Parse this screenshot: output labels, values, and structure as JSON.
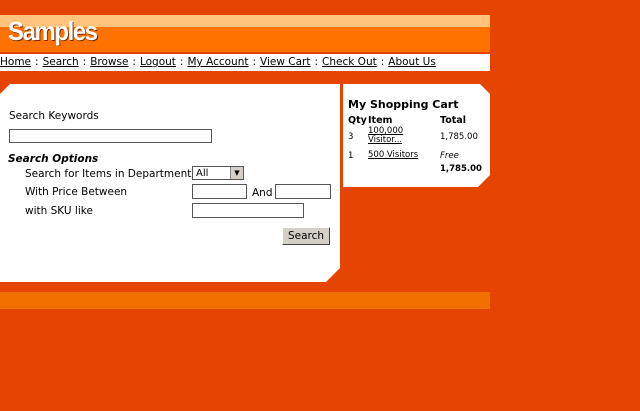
{
  "header": {
    "logo_text": "Samples"
  },
  "nav": {
    "items": [
      "Home",
      "Search",
      "Browse",
      "Logout",
      "My Account",
      "View Cart",
      "Check Out",
      "About Us"
    ],
    "separator": ":"
  },
  "search": {
    "keywords_label": "Search Keywords",
    "keywords_value": "",
    "options_title": "Search Options",
    "department_label": "Search for Items in Department",
    "department_selected": "All",
    "price_label": "With Price Between",
    "price_and": "And",
    "price_min": "",
    "price_max": "",
    "sku_label": "with SKU like",
    "sku_value": "",
    "button_label": "Search"
  },
  "cart": {
    "title": "My Shopping Cart",
    "headers": {
      "qty": "Qty",
      "item": "Item",
      "total": "Total"
    },
    "rows": [
      {
        "qty": "3",
        "item_line1": "100,000",
        "item_line2": "Visitor...",
        "total": "1,785.00"
      },
      {
        "qty": "1",
        "item_line1": "500 Visitors",
        "total": "Free"
      }
    ],
    "grand_total": "1,785.00"
  },
  "colors": {
    "background": "#e54500",
    "header_band": "#ff7200",
    "header_light": "#ffc37c",
    "footer_band": "#f07000"
  }
}
